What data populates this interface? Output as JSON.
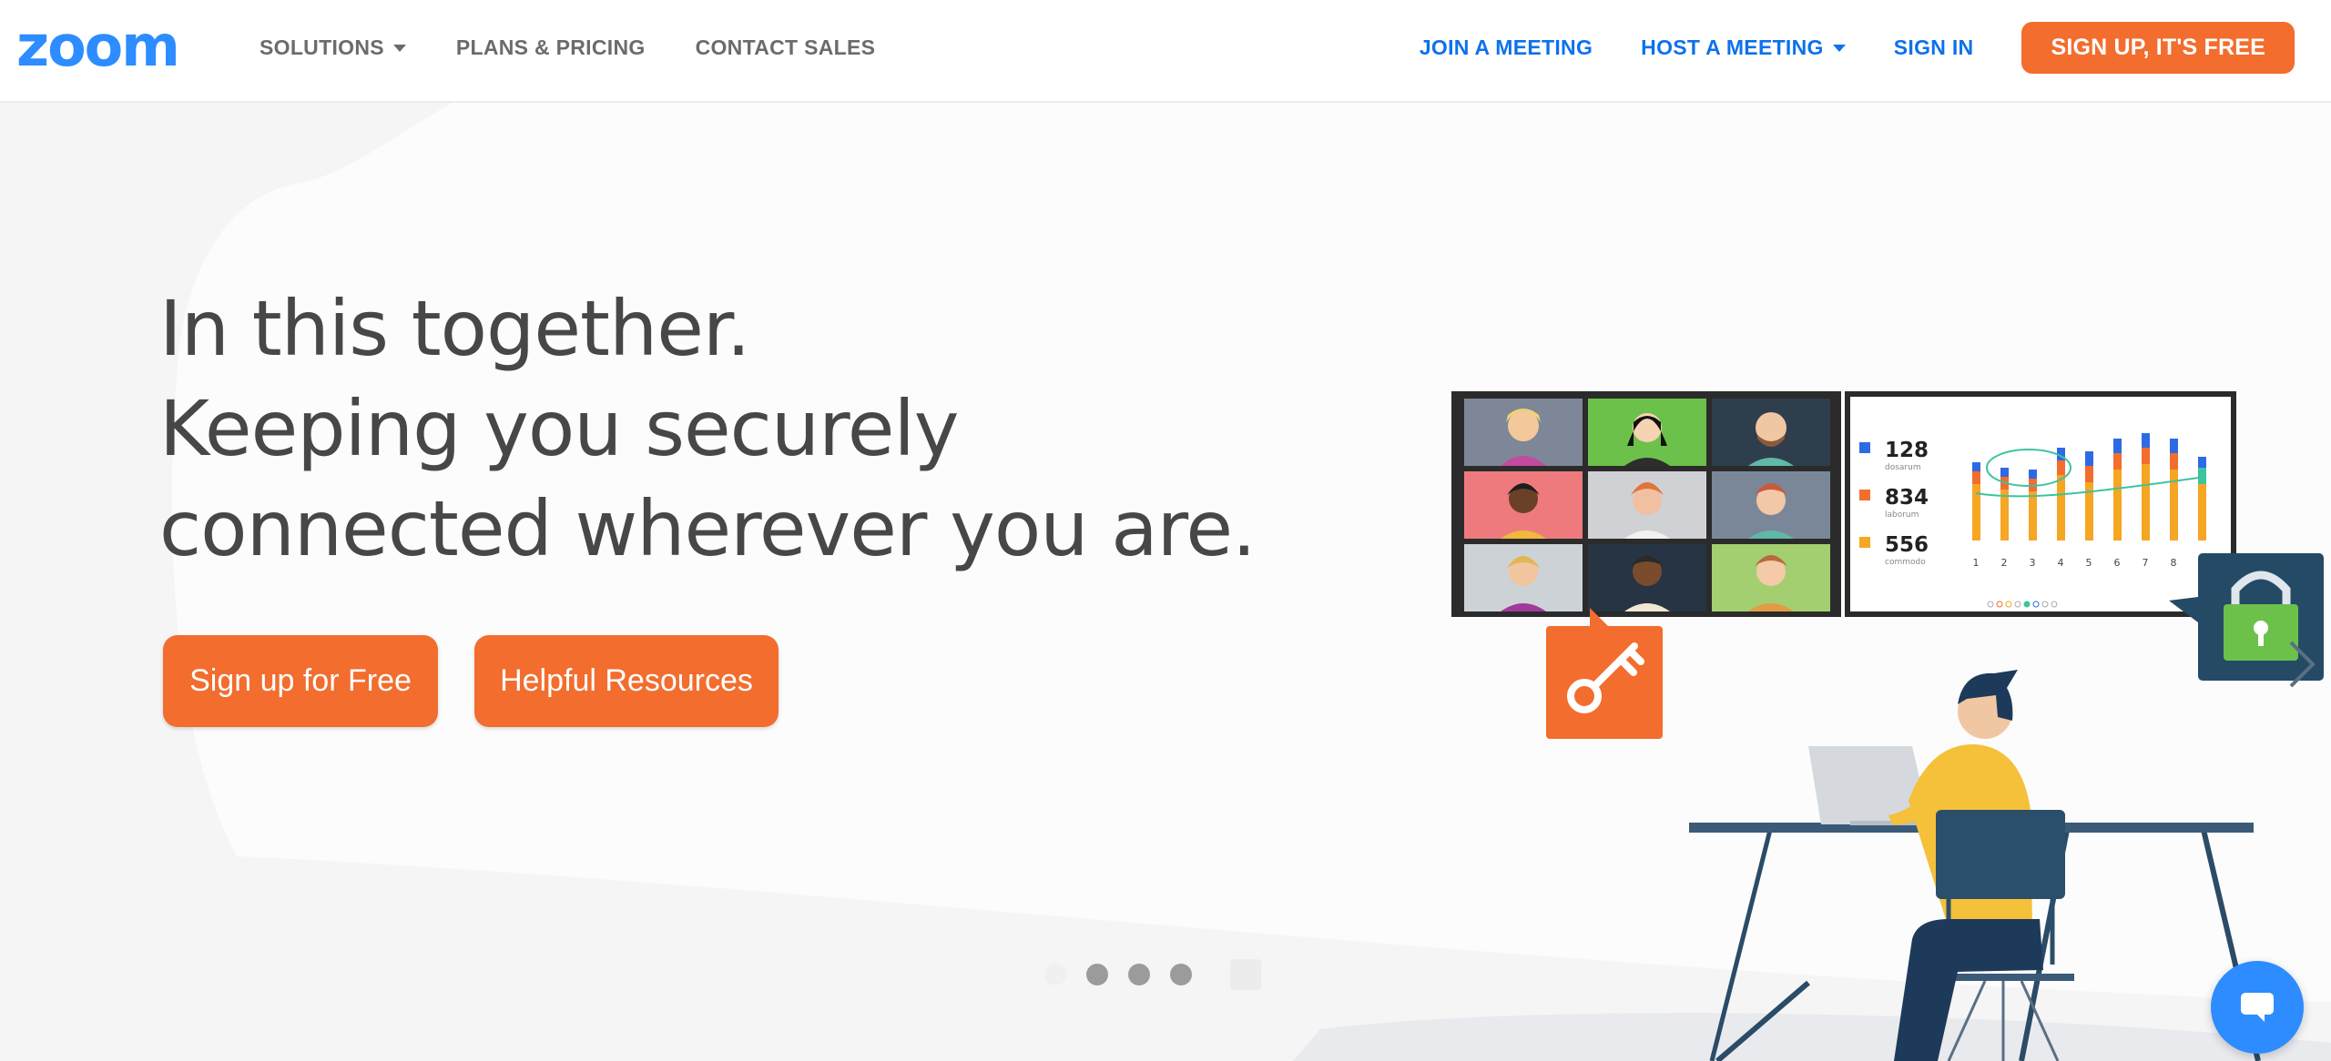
{
  "header": {
    "logo_text": "zoom",
    "nav_left": [
      {
        "label": "SOLUTIONS",
        "has_caret": true
      },
      {
        "label": "PLANS & PRICING",
        "has_caret": false
      },
      {
        "label": "CONTACT SALES",
        "has_caret": false
      }
    ],
    "nav_right": [
      {
        "label": "JOIN A MEETING",
        "has_caret": false
      },
      {
        "label": "HOST A MEETING",
        "has_caret": true
      },
      {
        "label": "SIGN IN",
        "has_caret": false
      }
    ],
    "signup_label": "SIGN UP, IT'S FREE"
  },
  "hero": {
    "headline": [
      "In this together.",
      "Keeping you securely",
      "connected wherever you are."
    ],
    "cta_primary": "Sign up for Free",
    "cta_secondary": "Helpful Resources",
    "carousel": {
      "slides": 5,
      "active_index": 0
    }
  },
  "illustration": {
    "stats": [
      {
        "value": "128",
        "label": "dosarum",
        "color": "#2d6be4"
      },
      {
        "value": "834",
        "label": "laborum",
        "color": "#f26d2e"
      },
      {
        "value": "556",
        "label": "commodo",
        "color": "#f5a623"
      }
    ],
    "chart_x_labels": [
      "1",
      "2",
      "3",
      "4",
      "5",
      "6",
      "7",
      "8"
    ]
  },
  "colors": {
    "brand_blue": "#0e71eb",
    "brand_orange": "#f26d2e",
    "chat_blue": "#2d8cff"
  },
  "icons": {
    "key": "key-icon",
    "lock": "lock-icon",
    "chat": "chat-icon",
    "next": "chevron-right-icon"
  }
}
